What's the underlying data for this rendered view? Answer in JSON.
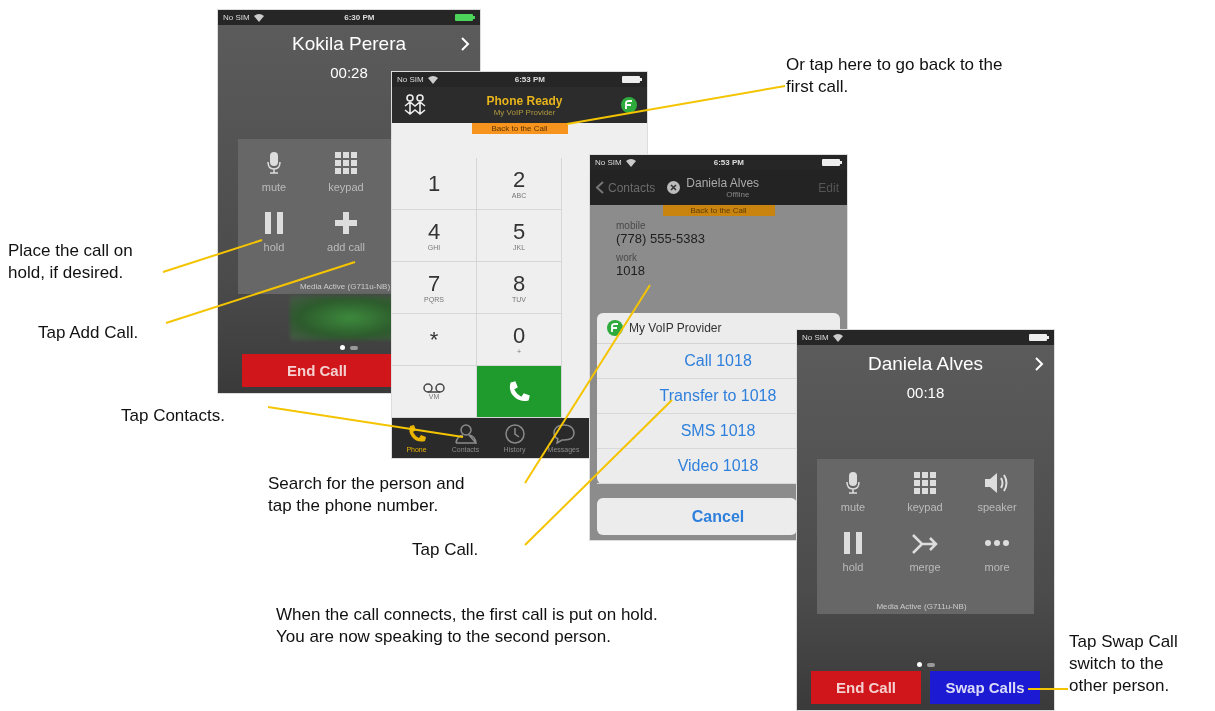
{
  "screens": [
    {
      "kind": "call",
      "status": {
        "carrier": "No SIM",
        "time": "6:30 PM",
        "charging": true
      },
      "name": "Kokila Perera",
      "timer": "00:28",
      "controls": [
        "mute",
        "keypad",
        "hold",
        "add call"
      ],
      "media": "Media Active (G711u-NB)",
      "video_preview": true,
      "buttons": [
        {
          "label": "End Call",
          "kind": "end"
        }
      ]
    },
    {
      "kind": "dialer",
      "status": {
        "carrier": "No SIM",
        "time": "6:53 PM"
      },
      "title": "Phone Ready",
      "subtitle": "My VoIP Provider",
      "banner": "Back to the Call",
      "keys": [
        {
          "kind": "digit",
          "digit": "1"
        },
        {
          "kind": "digit",
          "digit": "2",
          "letters": "ABC"
        },
        {
          "kind": "digit",
          "digit": "4",
          "letters": "GHI"
        },
        {
          "kind": "digit",
          "digit": "5",
          "letters": "JKL"
        },
        {
          "kind": "digit",
          "digit": "7",
          "letters": "PQRS"
        },
        {
          "kind": "digit",
          "digit": "8",
          "letters": "TUV"
        },
        {
          "kind": "digit",
          "digit": "*"
        },
        {
          "kind": "digit",
          "digit": "0",
          "letters": "+"
        },
        {
          "kind": "voicemail",
          "letters": "VM"
        },
        {
          "kind": "call"
        }
      ],
      "tabs": [
        {
          "label": "Phone",
          "selected": true
        },
        {
          "label": "Contacts",
          "selected": false
        },
        {
          "label": "History",
          "selected": false
        },
        {
          "label": "Messages",
          "selected": false
        }
      ]
    },
    {
      "kind": "contact",
      "status": {
        "carrier": "No SIM",
        "time": "6:53 PM"
      },
      "back": "Contacts",
      "name": "Daniela Alves",
      "presence": "Offline",
      "action": "Edit",
      "banner": "Back to the Call",
      "fields": [
        {
          "label": "mobile",
          "value": "(778) 555-5383"
        },
        {
          "label": "work",
          "value": "1018"
        }
      ],
      "sheet": {
        "title": "My VoIP Provider",
        "actions": [
          "Call 1018",
          "Transfer to 1018",
          "SMS 1018",
          "Video 1018"
        ],
        "cancel": "Cancel"
      }
    },
    {
      "kind": "call",
      "status": {
        "carrier": "No SIM"
      },
      "name": "Daniela Alves",
      "timer": "00:18",
      "controls": [
        "mute",
        "keypad",
        "speaker",
        "hold",
        "merge",
        "more"
      ],
      "media": "Media Active (G711u-NB)",
      "buttons": [
        {
          "label": "End Call",
          "kind": "end"
        },
        {
          "label": "Swap Calls",
          "kind": "swap"
        }
      ]
    }
  ],
  "callouts": [
    "Or tap here to go back to the\nfirst call.",
    "Place the call on\nhold, if desired.",
    "Tap Add Call.",
    "Tap Contacts.",
    "Search for the person and\ntap the phone number.",
    "Tap Call.",
    "When the call connects, the first call is put on hold.\nYou are now speaking to the second person.",
    "Tap Swap Call\nswitch to the\nother person."
  ]
}
